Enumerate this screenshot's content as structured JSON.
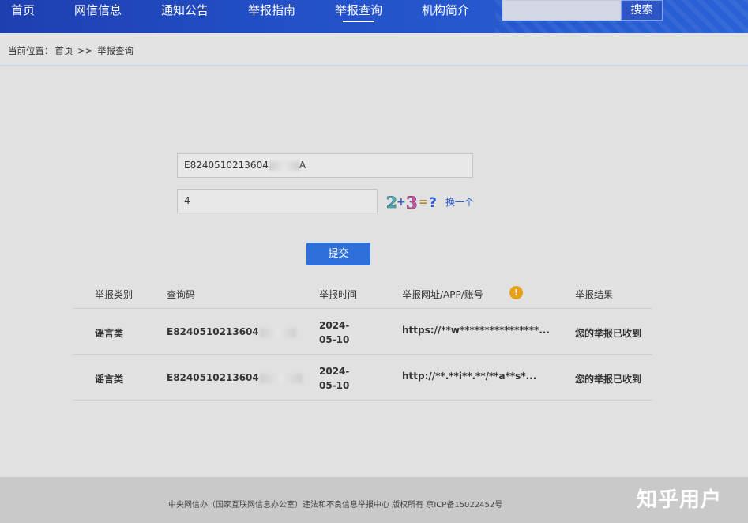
{
  "nav": {
    "items": [
      "首页",
      "网信信息",
      "通知公告",
      "举报指南",
      "举报查询",
      "机构简介"
    ],
    "active_index": 4,
    "search_button": "搜索",
    "search_value": ""
  },
  "breadcrumb": {
    "prefix": "当前位置：",
    "home": "首页",
    "separator": ">>",
    "current": "举报查询"
  },
  "form": {
    "query_code_value": "E8240510213604",
    "query_code_tail": "A",
    "captcha_answer": "4",
    "captcha_glyphs": [
      "2",
      "+",
      "3",
      "=",
      "?"
    ],
    "refresh_label": "换一个",
    "submit_label": "提交"
  },
  "table": {
    "headers": [
      "举报类别",
      "查询码",
      "举报时间",
      "举报网址/APP/账号",
      "举报结果"
    ],
    "header_warning_icon": "!",
    "rows": [
      {
        "category": "谣言类",
        "code": "E8240510213604",
        "time": "2024-05-10",
        "url": "https://**w****************...",
        "result": "您的举报已收到"
      },
      {
        "category": "谣言类",
        "code": "E8240510213604",
        "time": "2024-05-10",
        "url": "http://**.**i**.**/**a**s*...",
        "result": "您的举报已收到"
      }
    ]
  },
  "footer": {
    "copyright": "中央网信办（国家互联网信息办公室）违法和不良信息举报中心 版权所有 京ICP备15022452号"
  },
  "watermark": "知乎用户",
  "colors": {
    "nav_bg": "#2350c8",
    "submit_bg": "#2f6fd9",
    "warn": "#e6a118",
    "link": "#2a5bd7"
  }
}
